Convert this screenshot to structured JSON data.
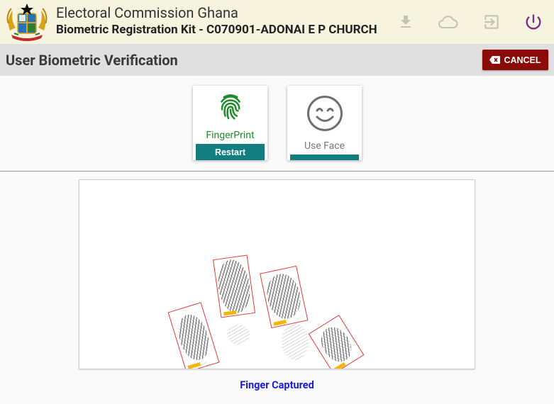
{
  "header": {
    "title": "Electoral Commission Ghana",
    "subtitle": "Biometric Registration Kit - C070901-ADONAI E  P CHURCH",
    "logo": "ghana-coat-of-arms",
    "actions": [
      {
        "name": "download-icon",
        "color": "#c4c4b2"
      },
      {
        "name": "cloud-icon",
        "color": "#c4c4b2"
      },
      {
        "name": "exit-icon",
        "color": "#c4c4b2"
      },
      {
        "name": "power-icon",
        "color": "#7b2a8f"
      }
    ]
  },
  "toolbar": {
    "page_title": "User Biometric Verification",
    "cancel_label": "CANCEL"
  },
  "modes": {
    "fingerprint": {
      "label": "FingerPrint",
      "button_label": "Restart",
      "icon": "fingerprint-icon",
      "color": "#1f8a2a"
    },
    "face": {
      "label": "Use Face",
      "button_label": "",
      "icon": "smiley-face-icon",
      "color": "#777777"
    }
  },
  "capture": {
    "image": "four-finger-slap-scan",
    "status": "Finger Captured",
    "status_color": "#1a1adb"
  },
  "colors": {
    "appbar_bg": "#f6f4df",
    "titlebar_bg": "#e0e0e0",
    "cancel_bg": "#8b0a0a",
    "teal": "#137e82"
  }
}
